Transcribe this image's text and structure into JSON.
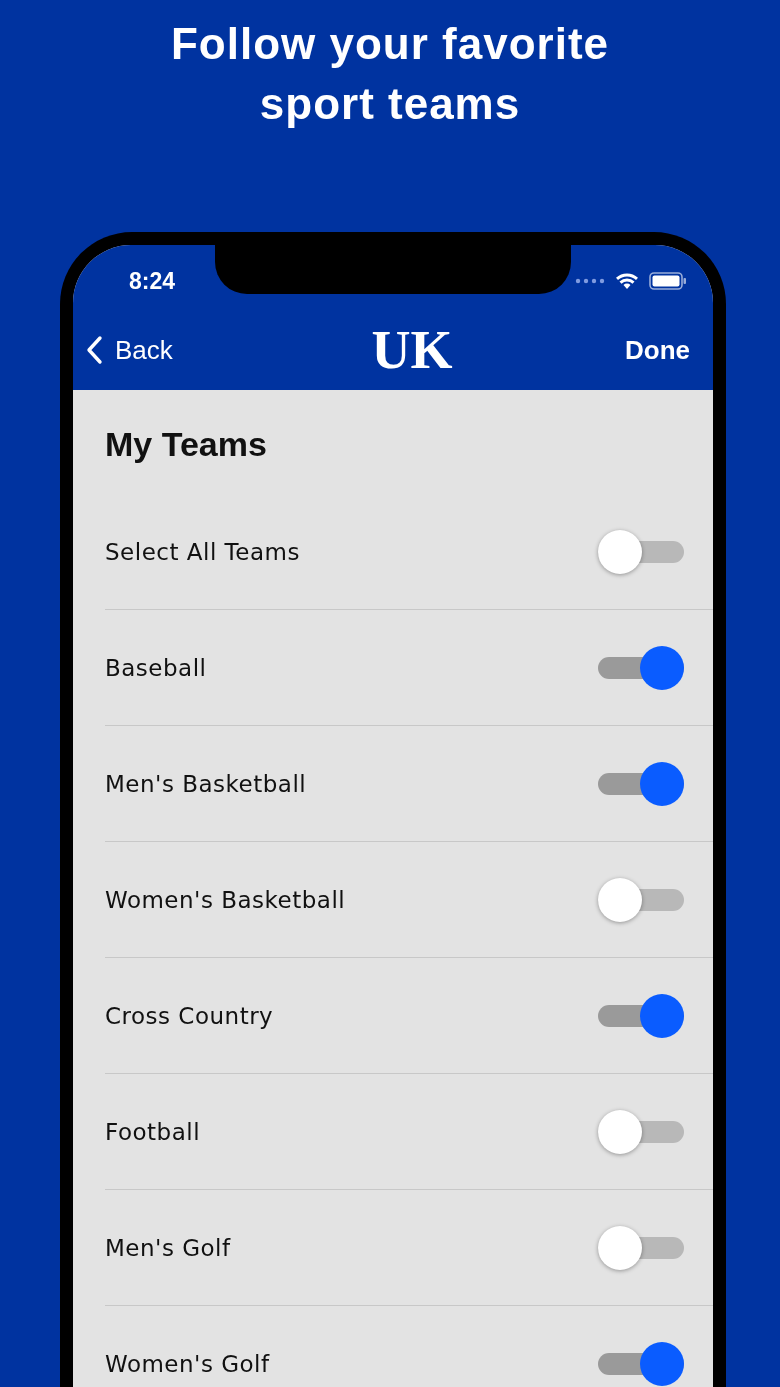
{
  "headline": "Follow your favorite sport teams",
  "status_bar": {
    "time": "8:24"
  },
  "nav": {
    "back": "Back",
    "logo": "UK",
    "done": "Done"
  },
  "title": "My Teams",
  "teams": [
    {
      "name": "Select All Teams",
      "on": false
    },
    {
      "name": "Baseball",
      "on": true
    },
    {
      "name": "Men's Basketball",
      "on": true
    },
    {
      "name": "Women's Basketball",
      "on": false
    },
    {
      "name": "Cross Country",
      "on": true
    },
    {
      "name": "Football",
      "on": false
    },
    {
      "name": "Men's Golf",
      "on": false
    },
    {
      "name": "Women's Golf",
      "on": true
    }
  ]
}
